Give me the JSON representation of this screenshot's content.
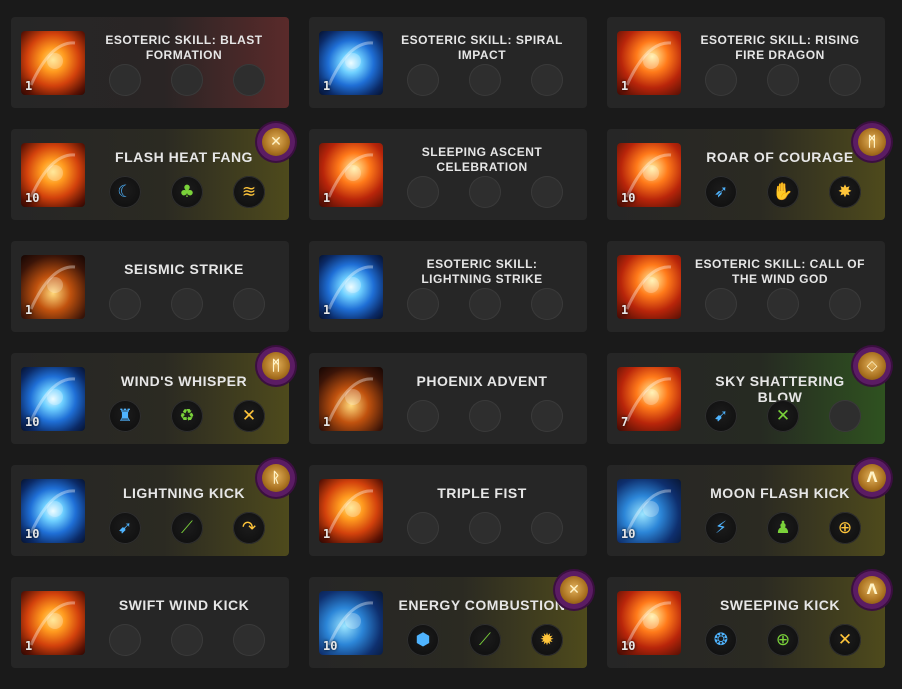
{
  "colors": {
    "background": "#1a1a1a",
    "card": "#262626",
    "tint_red": "#5a2a2a",
    "tint_yellow": "#4e4a1c",
    "tint_green": "#2f5220",
    "rune_ring": "#5b1c63",
    "gem_blue": "#4fb4ff",
    "gem_green": "#7ad23a",
    "gem_yellow": "#ffc53a"
  },
  "cards": [
    {
      "title": "ESOTERIC SKILL: BLAST FORMATION",
      "level": "1",
      "icon": "fire-blast-icon",
      "tint": "red",
      "rune": null,
      "gems": [
        null,
        null,
        null
      ]
    },
    {
      "title": "ESOTERIC SKILL: SPIRAL IMPACT",
      "level": "1",
      "icon": "spiral-impact-icon",
      "tint": "none",
      "rune": null,
      "gems": [
        null,
        null,
        null
      ]
    },
    {
      "title": "ESOTERIC SKILL: RISING FIRE DRAGON",
      "level": "1",
      "icon": "fire-dragon-icon",
      "tint": "none",
      "rune": null,
      "gems": [
        null,
        null,
        null
      ]
    },
    {
      "title": "FLASH HEAT FANG",
      "level": "10",
      "icon": "flash-heat-fang-icon",
      "tint": "yellow",
      "rune": {
        "glyph": "✕",
        "name": "rune-icon"
      },
      "gems": [
        {
          "glyph": "☾",
          "color": "blue",
          "name": "crescent-moon-icon"
        },
        {
          "glyph": "♣",
          "color": "green",
          "name": "beast-head-icon"
        },
        {
          "glyph": "≋",
          "color": "yellow",
          "name": "flame-wave-icon"
        }
      ]
    },
    {
      "title": "SLEEPING ASCENT CELEBRATION",
      "level": "1",
      "icon": "sleeping-ascent-icon",
      "tint": "none",
      "rune": null,
      "gems": [
        null,
        null,
        null
      ]
    },
    {
      "title": "ROAR OF COURAGE",
      "level": "10",
      "icon": "roar-of-courage-icon",
      "tint": "yellow",
      "rune": {
        "glyph": "ᛗ",
        "name": "rune-icon"
      },
      "gems": [
        {
          "glyph": "➶",
          "color": "blue",
          "name": "bird-icon"
        },
        {
          "glyph": "✋",
          "color": "green",
          "name": "grasp-icon"
        },
        {
          "glyph": "✸",
          "color": "yellow",
          "name": "burst-icon"
        }
      ]
    },
    {
      "title": "SEISMIC STRIKE",
      "level": "1",
      "icon": "seismic-strike-icon",
      "tint": "none",
      "rune": null,
      "gems": [
        null,
        null,
        null
      ]
    },
    {
      "title": "ESOTERIC SKILL: LIGHTNING STRIKE",
      "level": "1",
      "icon": "lightning-strike-icon",
      "tint": "none",
      "rune": null,
      "gems": [
        null,
        null,
        null
      ]
    },
    {
      "title": "ESOTERIC SKILL: CALL OF THE WIND GOD",
      "level": "1",
      "icon": "wind-god-icon",
      "tint": "none",
      "rune": null,
      "gems": [
        null,
        null,
        null
      ]
    },
    {
      "title": "WIND'S WHISPER",
      "level": "10",
      "icon": "winds-whisper-icon",
      "tint": "yellow",
      "rune": {
        "glyph": "ᛗ",
        "name": "rune-icon"
      },
      "gems": [
        {
          "glyph": "♜",
          "color": "blue",
          "name": "gauntlet-icon"
        },
        {
          "glyph": "♻",
          "color": "green",
          "name": "recycle-icon"
        },
        {
          "glyph": "✕",
          "color": "yellow",
          "name": "crossed-blades-icon"
        }
      ]
    },
    {
      "title": "PHOENIX ADVENT",
      "level": "1",
      "icon": "phoenix-advent-icon",
      "tint": "none",
      "rune": null,
      "gems": [
        null,
        null,
        null
      ]
    },
    {
      "title": "SKY SHATTERING BLOW",
      "level": "7",
      "icon": "sky-shattering-icon",
      "tint": "green",
      "rune": {
        "glyph": "◇",
        "name": "rune-icon"
      },
      "gems": [
        {
          "glyph": "➹",
          "color": "blue",
          "name": "dash-icon"
        },
        {
          "glyph": "✕",
          "color": "green",
          "name": "crossed-swords-icon"
        },
        null
      ]
    },
    {
      "title": "LIGHTNING KICK",
      "level": "10",
      "icon": "lightning-kick-icon",
      "tint": "yellow",
      "rune": {
        "glyph": "ᚱ",
        "name": "rune-icon"
      },
      "gems": [
        {
          "glyph": "➹",
          "color": "blue",
          "name": "dash-icon"
        },
        {
          "glyph": "⟋",
          "color": "green",
          "name": "slash-icon"
        },
        {
          "glyph": "↷",
          "color": "yellow",
          "name": "turn-arrow-icon"
        }
      ]
    },
    {
      "title": "TRIPLE FIST",
      "level": "1",
      "icon": "triple-fist-icon",
      "tint": "none",
      "rune": null,
      "gems": [
        null,
        null,
        null
      ]
    },
    {
      "title": "MOON FLASH KICK",
      "level": "10",
      "icon": "moon-flash-kick-icon",
      "tint": "yellow",
      "rune": {
        "glyph": "ᐱ",
        "name": "rune-icon"
      },
      "gems": [
        {
          "glyph": "⚡",
          "color": "blue",
          "name": "claw-icon"
        },
        {
          "glyph": "♟",
          "color": "green",
          "name": "figure-icon"
        },
        {
          "glyph": "⊕",
          "color": "yellow",
          "name": "compass-icon"
        }
      ]
    },
    {
      "title": "SWIFT WIND KICK",
      "level": "1",
      "icon": "swift-wind-kick-icon",
      "tint": "none",
      "rune": null,
      "gems": [
        null,
        null,
        null
      ]
    },
    {
      "title": "ENERGY COMBUSTION",
      "level": "10",
      "icon": "energy-combustion-icon",
      "tint": "yellow",
      "rune": {
        "glyph": "✕",
        "name": "rune-icon"
      },
      "gems": [
        {
          "glyph": "⬢",
          "color": "blue",
          "name": "shield-icon"
        },
        {
          "glyph": "⟋",
          "color": "green",
          "name": "slash-icon"
        },
        {
          "glyph": "✹",
          "color": "yellow",
          "name": "sun-burst-icon"
        }
      ]
    },
    {
      "title": "SWEEPING KICK",
      "level": "10",
      "icon": "sweeping-kick-icon",
      "tint": "yellow",
      "rune": {
        "glyph": "ᐱ",
        "name": "rune-icon"
      },
      "gems": [
        {
          "glyph": "❂",
          "color": "blue",
          "name": "orb-icon"
        },
        {
          "glyph": "⊕",
          "color": "green",
          "name": "target-icon"
        },
        {
          "glyph": "✕",
          "color": "yellow",
          "name": "blades-icon"
        }
      ]
    }
  ]
}
